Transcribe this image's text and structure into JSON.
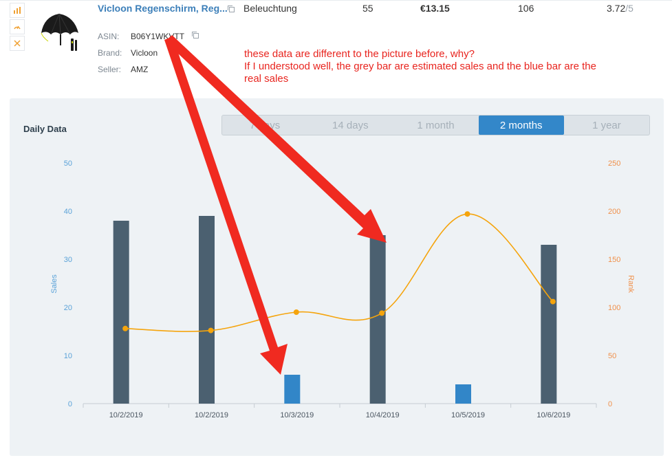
{
  "product": {
    "title": "Vicloon Regenschirm, Reg...",
    "category": "Beleuchtung",
    "col_a": "55",
    "price": "€13.15",
    "col_b": "106",
    "rating_value": "3.72",
    "rating_max": "/5",
    "asin_label": "ASIN:",
    "asin": "B06Y1WKVTT",
    "brand_label": "Brand:",
    "brand": "Vicloon",
    "seller_label": "Seller:",
    "seller": "AMZ"
  },
  "annotation": {
    "line1": "these data are different to the picture before, why?",
    "line2": "If I understood well, the grey bar are estimated sales and the blue bar are the",
    "line3": "real sales",
    "color": "#e8241e"
  },
  "panel": {
    "title": "Daily Data",
    "tabs": [
      {
        "label": "7 days",
        "active": false
      },
      {
        "label": "14 days",
        "active": false
      },
      {
        "label": "1 month",
        "active": false
      },
      {
        "label": "2 months",
        "active": true
      },
      {
        "label": "1 year",
        "active": false
      }
    ]
  },
  "chart_data": {
    "type": "bar",
    "categories": [
      "10/2/2019",
      "10/2/2019",
      "10/3/2019",
      "10/4/2019",
      "10/5/2019",
      "10/6/2019"
    ],
    "ylabel": "Sales",
    "y2label": "Rank",
    "ylim": [
      0,
      50
    ],
    "y2lim": [
      0,
      250
    ],
    "yticks": [
      "0",
      "10",
      "20",
      "30",
      "40",
      "50"
    ],
    "y2ticks": [
      "0",
      "50",
      "100",
      "150",
      "200",
      "250"
    ],
    "bars": [
      {
        "slot": 0.5,
        "value": 38,
        "kind": "estimated"
      },
      {
        "slot": 1.5,
        "value": 39,
        "kind": "estimated"
      },
      {
        "slot": 2.5,
        "value": 6,
        "kind": "real"
      },
      {
        "slot": 3.5,
        "value": 35,
        "kind": "estimated"
      },
      {
        "slot": 4.5,
        "value": 4,
        "kind": "real"
      },
      {
        "slot": 5.5,
        "value": 33,
        "kind": "estimated"
      }
    ],
    "rank_series": [
      {
        "slot": 0.5,
        "value": 78
      },
      {
        "slot": 1.5,
        "value": 76
      },
      {
        "slot": 2.5,
        "value": 95
      },
      {
        "slot": 3.5,
        "value": 94
      },
      {
        "slot": 4.5,
        "value": 197
      },
      {
        "slot": 5.5,
        "value": 106
      }
    ],
    "colors": {
      "estimated_bar": "#4b6070",
      "real_bar": "#3286c8",
      "rank_line": "#f5a40c",
      "sales_axis": "#5aa2d8",
      "rank_axis": "#f0904a"
    }
  }
}
